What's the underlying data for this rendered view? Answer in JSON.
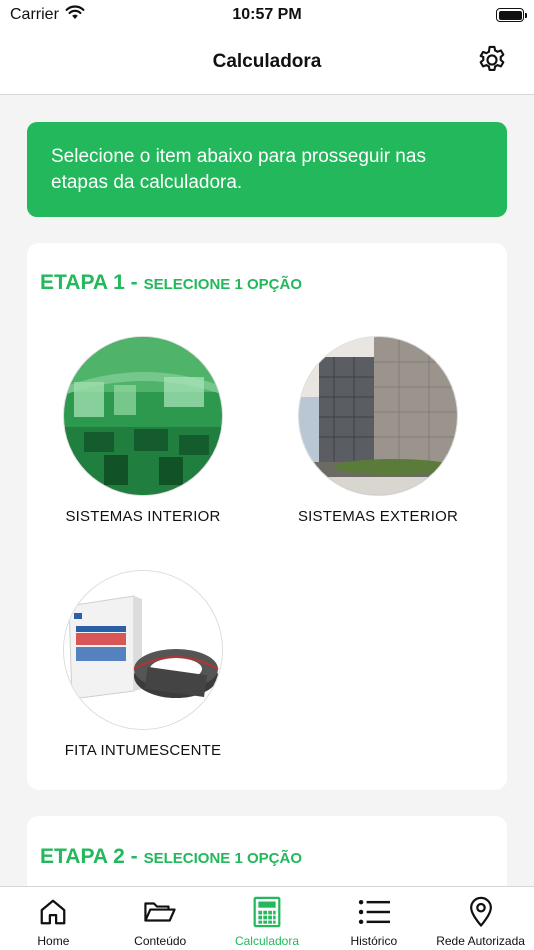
{
  "status_bar": {
    "carrier": "Carrier",
    "time": "10:57 PM"
  },
  "header": {
    "title": "Calculadora",
    "settings_icon": "gear-icon"
  },
  "banner": {
    "text": "Selecione o item abaixo para prosseguir nas etapas da calculadora."
  },
  "steps": [
    {
      "title": "ETAPA 1 -",
      "subtitle": "SELECIONE 1 OPÇÃO",
      "options": [
        {
          "label": "SISTEMAS INTERIOR"
        },
        {
          "label": "SISTEMAS EXTERIOR"
        },
        {
          "label": "FITA INTUMESCENTE"
        }
      ]
    },
    {
      "title": "ETAPA 2 -",
      "subtitle": "SELECIONE 1 OPÇÃO"
    }
  ],
  "tab_bar": {
    "tabs": [
      {
        "label": "Home",
        "icon": "home-icon"
      },
      {
        "label": "Conteúdo",
        "icon": "folder-open-icon"
      },
      {
        "label": "Calculadora",
        "icon": "calculator-icon",
        "active": true
      },
      {
        "label": "Histórico",
        "icon": "list-icon"
      },
      {
        "label": "Rede Autorizada",
        "icon": "location-pin-icon"
      }
    ]
  },
  "colors": {
    "accent": "#22b85b",
    "background": "#f4f4f4",
    "card": "#ffffff",
    "text": "#111111"
  }
}
